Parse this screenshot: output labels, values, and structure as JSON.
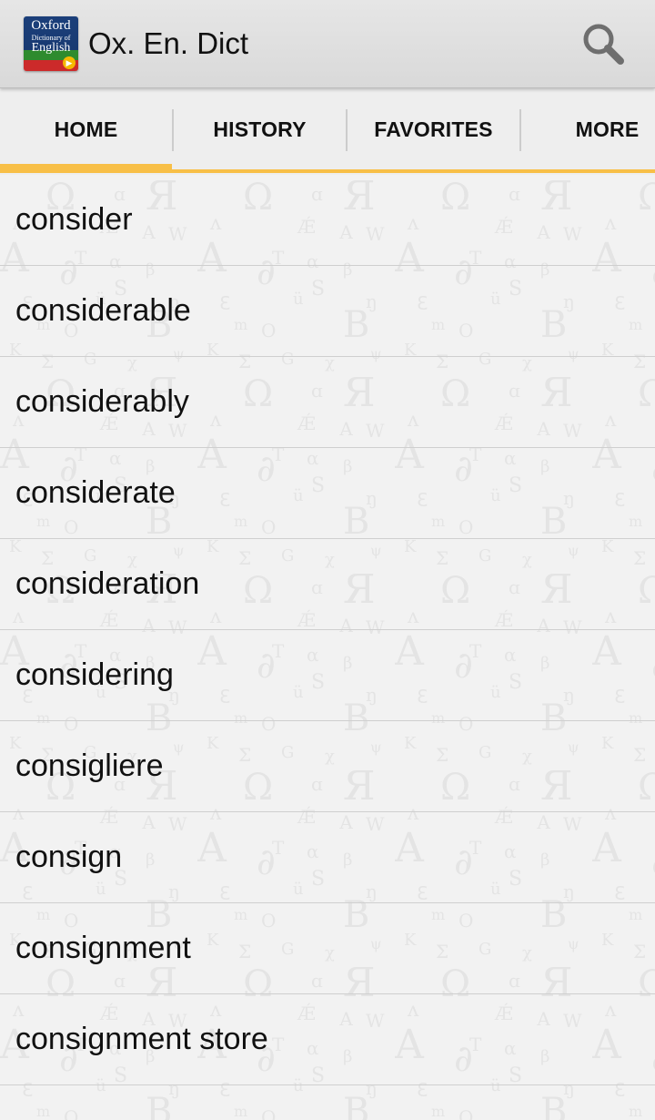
{
  "header": {
    "logo_text_top": "Oxford",
    "logo_text_mid": "Dictionary of",
    "logo_text_bottom": "English",
    "title": "Ox. En. Dict",
    "search_icon": "search-icon"
  },
  "tabs": [
    {
      "label": "HOME",
      "selected": true
    },
    {
      "label": "HISTORY",
      "selected": false
    },
    {
      "label": "FAVORITES",
      "selected": false
    },
    {
      "label": "MORE",
      "selected": false
    }
  ],
  "accent_color": "#f8bf47",
  "words": [
    "consider",
    "considerable",
    "considerably",
    "considerate",
    "consideration",
    "considering",
    "consigliere",
    "consign",
    "consignment",
    "consignment store"
  ]
}
